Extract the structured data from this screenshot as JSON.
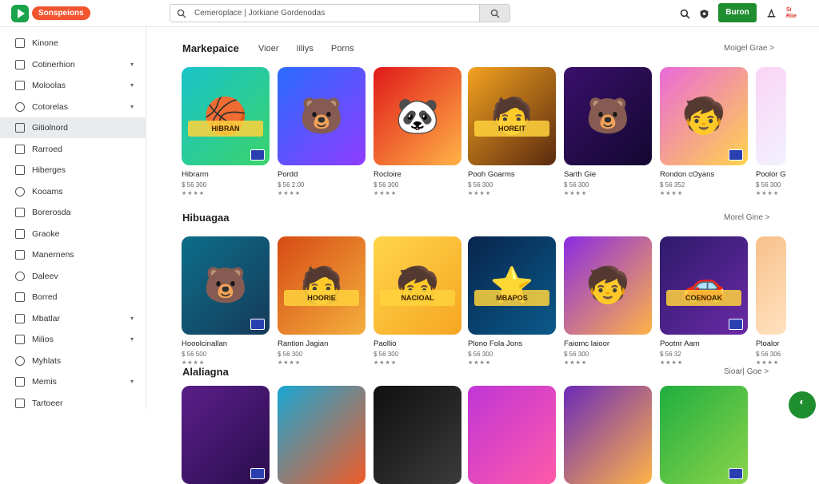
{
  "header": {
    "brand": "Sonspeions",
    "search_value": "Cemeroplace | Jorkiane Gordenodas",
    "action_button": "Buron",
    "flag_text": "Si\nRiie"
  },
  "sidebar": {
    "items": [
      {
        "label": "Kinone",
        "chevron": false,
        "active": false
      },
      {
        "label": "Cotinerhion",
        "chevron": true,
        "active": false
      },
      {
        "label": "Moloolas",
        "chevron": true,
        "active": false
      },
      {
        "label": "Cotorelas",
        "chevron": true,
        "active": false
      },
      {
        "label": "Gitiolnord",
        "chevron": false,
        "active": true
      },
      {
        "label": "Rarroed",
        "chevron": false,
        "active": false
      },
      {
        "label": "Hiberges",
        "chevron": false,
        "active": false
      },
      {
        "label": "Kooams",
        "chevron": false,
        "active": false
      },
      {
        "label": "Borerosda",
        "chevron": false,
        "active": false
      },
      {
        "label": "Graoke",
        "chevron": false,
        "active": false
      },
      {
        "label": "Manernens",
        "chevron": false,
        "active": false
      },
      {
        "label": "Daleev",
        "chevron": false,
        "active": false
      },
      {
        "label": "Borred",
        "chevron": false,
        "active": false
      },
      {
        "label": "Mbatlar",
        "chevron": true,
        "active": false
      },
      {
        "label": "Milios",
        "chevron": true,
        "active": false
      },
      {
        "label": "Myhlats",
        "chevron": false,
        "active": false
      },
      {
        "label": "Memis",
        "chevron": true,
        "active": false
      },
      {
        "label": "Tartoeer",
        "chevron": false,
        "active": false
      }
    ]
  },
  "sections": [
    {
      "title": "Markepaice",
      "tabs": [
        "Vioer",
        "Iiliys",
        "Porns"
      ],
      "more": "Moigel Grae >",
      "cards": [
        {
          "name": "Hibrarm",
          "price": "$ 56 300",
          "stars": "★★★★",
          "banner": "HIBRAN",
          "colors": [
            "#19c3c9",
            "#3ad36b"
          ],
          "glyph": "🏀"
        },
        {
          "name": "Pordd",
          "price": "$ 56 2.00",
          "stars": "★★★★",
          "banner": "",
          "colors": [
            "#2a6cff",
            "#8f3cff"
          ],
          "glyph": "🐻"
        },
        {
          "name": "Rocloire",
          "price": "$ 56 300",
          "stars": "★★★★",
          "banner": "",
          "colors": [
            "#e01919",
            "#ffb347"
          ],
          "glyph": "🐼"
        },
        {
          "name": "Pooh Goarms",
          "price": "$ 56 300",
          "stars": "★★★★",
          "banner": "HOREIT",
          "colors": [
            "#f3a21f",
            "#5a2a0f"
          ],
          "glyph": "🧑"
        },
        {
          "name": "Sarth Gie",
          "price": "$ 56 300",
          "stars": "★★★★",
          "banner": "",
          "colors": [
            "#3b0f6b",
            "#120830"
          ],
          "glyph": "🐻"
        },
        {
          "name": "Rondon cOyans",
          "price": "$ 56 352",
          "stars": "★★★★",
          "banner": "",
          "colors": [
            "#e96ad8",
            "#ffd34d"
          ],
          "glyph": "🧒"
        },
        {
          "name": "Poolor Ga",
          "price": "$ 56 300",
          "stars": "★★★★",
          "banner": "",
          "colors": [
            "#fbd3f5",
            "#f2f2ff"
          ],
          "glyph": ""
        }
      ]
    },
    {
      "title": "Hibuagaa",
      "tabs": [],
      "more": "Morel Gine >",
      "cards": [
        {
          "name": "Hooolcinallan",
          "price": "$ 56 500",
          "stars": "★★★★",
          "banner": "",
          "colors": [
            "#0c6e8a",
            "#163a5a"
          ],
          "glyph": "🐻"
        },
        {
          "name": "Rantion Jagian",
          "price": "$ 56 300",
          "stars": "★★★★",
          "banner": "HOORIE",
          "colors": [
            "#d64b14",
            "#f4b03e"
          ],
          "glyph": "🧑"
        },
        {
          "name": "Paollio",
          "price": "$ 56 300",
          "stars": "★★★★",
          "banner": "NACIOAL",
          "colors": [
            "#ffd54a",
            "#f6a623"
          ],
          "glyph": "🧒"
        },
        {
          "name": "Plono Fola Jons",
          "price": "$ 56 300",
          "stars": "★★★★",
          "banner": "MBAPOS",
          "colors": [
            "#08254d",
            "#0a5a8a"
          ],
          "glyph": "⭐"
        },
        {
          "name": "Faiomc laioor",
          "price": "$ 56 300",
          "stars": "★★★★",
          "banner": "",
          "colors": [
            "#8a2be2",
            "#ffb347"
          ],
          "glyph": "🧒"
        },
        {
          "name": "Pootnr Aam",
          "price": "$ 56 32",
          "stars": "★★★★",
          "banner": "COENOAK",
          "colors": [
            "#2d1a6b",
            "#6a2aa6"
          ],
          "glyph": "🚗"
        },
        {
          "name": "Ploalor",
          "price": "$ 56 306",
          "stars": "★★★★",
          "banner": "",
          "colors": [
            "#f7c08a",
            "#ffe2c0"
          ],
          "glyph": ""
        }
      ]
    },
    {
      "title": "Alaliagna",
      "tabs": [],
      "more": "Sioar| Goe >",
      "cards": [
        {
          "name": "",
          "price": "",
          "stars": "",
          "banner": "",
          "colors": [
            "#5a1f8a",
            "#2b0d4d"
          ],
          "glyph": ""
        },
        {
          "name": "",
          "price": "",
          "stars": "",
          "banner": "",
          "colors": [
            "#19a7d4",
            "#f05a28"
          ],
          "glyph": ""
        },
        {
          "name": "",
          "price": "",
          "stars": "",
          "banner": "",
          "colors": [
            "#101010",
            "#3a3a3a"
          ],
          "glyph": ""
        },
        {
          "name": "",
          "price": "",
          "stars": "",
          "banner": "",
          "colors": [
            "#c035d8",
            "#ff5aa8"
          ],
          "glyph": ""
        },
        {
          "name": "",
          "price": "",
          "stars": "",
          "banner": "",
          "colors": [
            "#6b2ab8",
            "#ffb347"
          ],
          "glyph": ""
        },
        {
          "name": "",
          "price": "",
          "stars": "",
          "banner": "",
          "colors": [
            "#1fae3f",
            "#8bd44a"
          ],
          "glyph": ""
        }
      ]
    }
  ],
  "icons": {
    "search": "search-icon",
    "shield": "shield-icon",
    "notification": "bell-icon",
    "fab": "chat-icon"
  },
  "colors": {
    "accent": "#1e8e2f",
    "brand_pill": "#f2542d"
  }
}
